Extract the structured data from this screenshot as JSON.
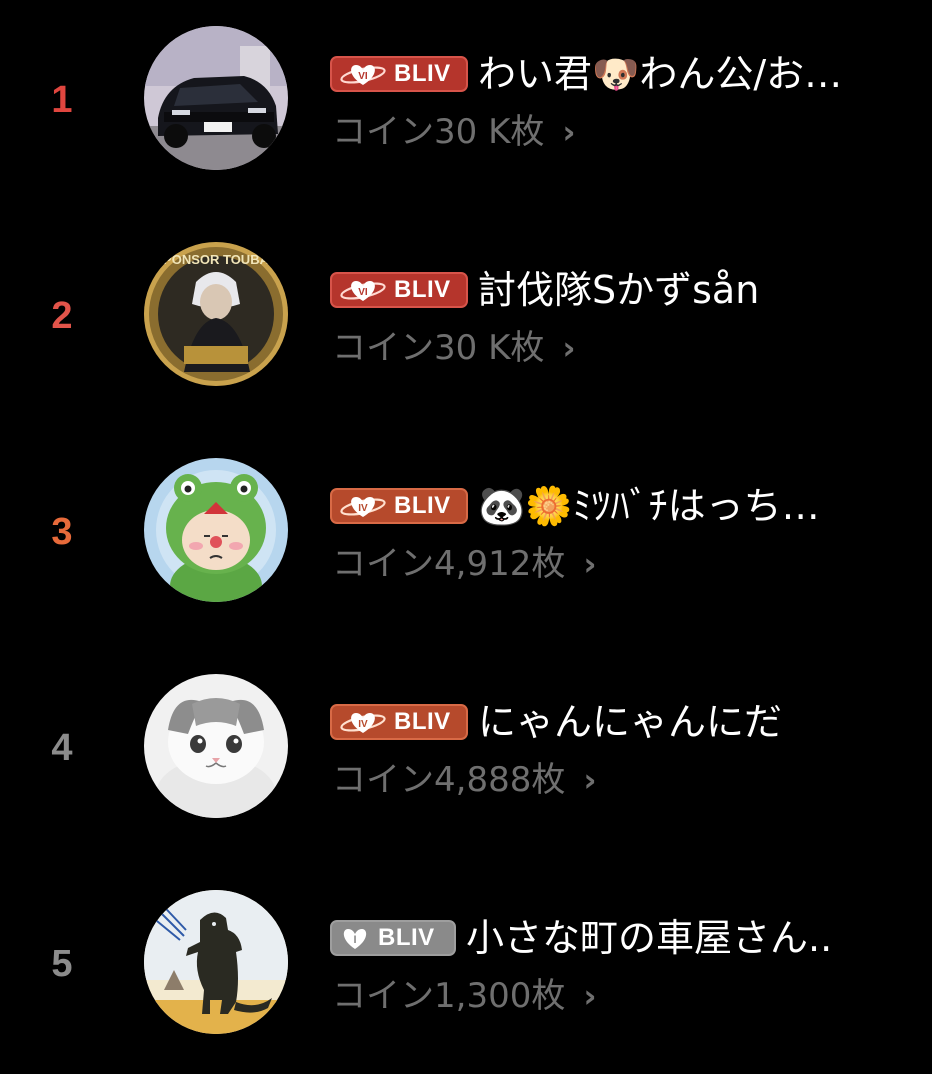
{
  "ranking": [
    {
      "rank": "1",
      "rank_color": "#e0463f",
      "badge_level": "VI",
      "badge_label": "BLIV",
      "badge_style": "red",
      "name": "わい君🐶わん公/お…",
      "coins": "コイン30 K枚",
      "chevron": "›"
    },
    {
      "rank": "2",
      "rank_color": "#e2544a",
      "badge_level": "VI",
      "badge_label": "BLIV",
      "badge_style": "red",
      "name": "討伐隊Sかずsån",
      "coins": "コイン30 K枚",
      "chevron": "›"
    },
    {
      "rank": "3",
      "rank_color": "#e76a3a",
      "badge_level": "IV",
      "badge_label": "BLIV",
      "badge_style": "orange",
      "name": "🐼🌼ﾐﾂﾊﾞﾁはっち…",
      "coins": "コイン4,912枚",
      "chevron": "›"
    },
    {
      "rank": "4",
      "rank_color": "#8c8c8c",
      "badge_level": "IV",
      "badge_label": "BLIV",
      "badge_style": "orange",
      "name": "にゃんにゃんにだ",
      "coins": "コイン4,888枚",
      "chevron": "›"
    },
    {
      "rank": "5",
      "rank_color": "#8c8c8c",
      "badge_level": "I",
      "badge_label": "BLIV",
      "badge_style": "gray",
      "name": "小さな町の車屋さん..",
      "coins": "コイン1,300枚",
      "chevron": "›"
    }
  ]
}
